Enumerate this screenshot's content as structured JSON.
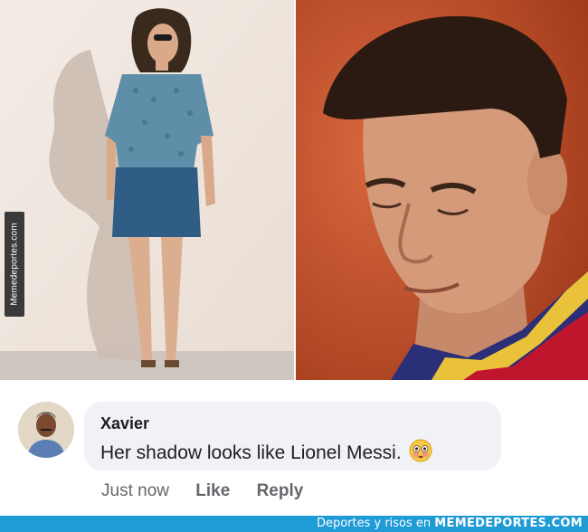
{
  "watermark": {
    "side_text": "Memedeportes.com"
  },
  "comment": {
    "author": "Xavier",
    "text": "Her shadow looks like Lionel Messi.",
    "emoji": "flushed-face-emoji",
    "timestamp": "Just now",
    "like_label": "Like",
    "reply_label": "Reply"
  },
  "footer": {
    "prefix": "Deportes y risos en",
    "brand": "MEMEDEPORTES.COM"
  },
  "colors": {
    "bubble": "#f0f2f5",
    "footer_bar": "#1f9bd6",
    "meta_text": "#65676b",
    "name_text": "#1c1e21"
  }
}
